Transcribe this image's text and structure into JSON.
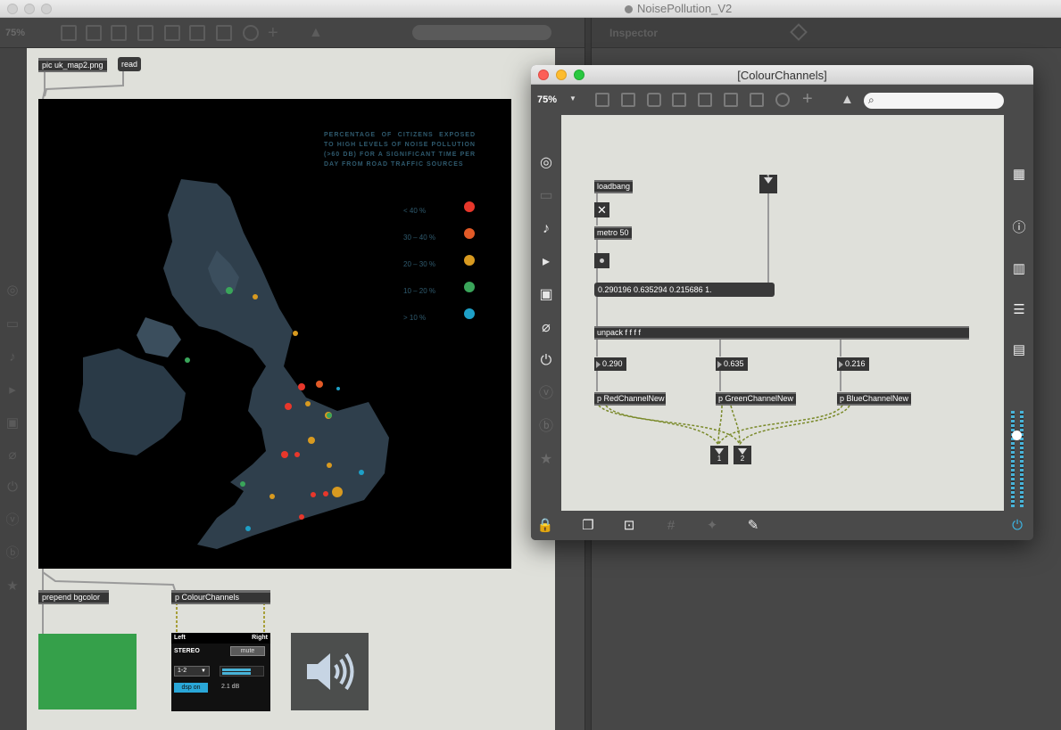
{
  "main_window": {
    "title": "NoisePollution_V2",
    "zoom": "75%",
    "inspector_label": "Inspector"
  },
  "patcher": {
    "pic_object": "pic uk_map2.png",
    "read_message": "read",
    "prepend_object": "prepend bgcolor",
    "subpatch_object": "p ColourChannels"
  },
  "map": {
    "legend_title": "PERCENTAGE OF CITIZENS EXPOSED TO HIGH LEVELS OF NOISE POLLUTION (>60 DB) FOR A SIGNIFICANT TIME PER DAY FROM ROAD TRAFFIC SOURCES",
    "legend": [
      {
        "label": "< 40 %",
        "color": "#e8372b"
      },
      {
        "label": "30 – 40 %",
        "color": "#e25a27"
      },
      {
        "label": "20 – 30 %",
        "color": "#d89a20"
      },
      {
        "label": "10 – 20 %",
        "color": "#3aa55a"
      },
      {
        "label": "> 10 %",
        "color": "#1ea0c7"
      }
    ]
  },
  "swatch": {
    "color": "#35a04a"
  },
  "ezdac": {
    "left": "Left",
    "right": "Right",
    "stereo": "STEREO",
    "mute": "mute",
    "channels": "1-2",
    "dsp": "dsp on",
    "level": "2.1 dB"
  },
  "colour_window": {
    "title": "[ColourChannels]",
    "zoom": "75%",
    "objects": {
      "loadbang": "loadbang",
      "metro": "metro 50",
      "inlet_label": "1",
      "rgb_message": "0.290196 0.635294 0.215686 1.",
      "unpack": "unpack f f f f",
      "num_r": "0.290",
      "num_g": "0.635",
      "num_b": "0.216",
      "red": "p RedChannelNew",
      "green": "p GreenChannelNew",
      "blue": "p BlueChannelNew",
      "out1": "1",
      "out2": "2"
    }
  }
}
